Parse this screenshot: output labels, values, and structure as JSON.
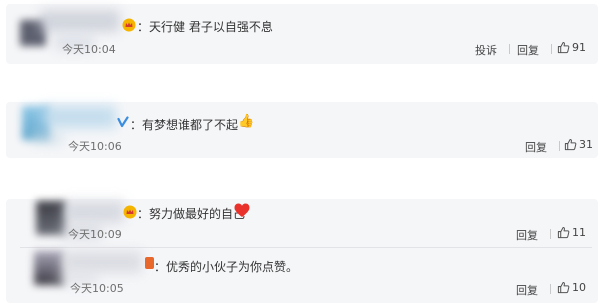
{
  "comments": [
    {
      "text": "：天行健 君子以自强不息",
      "time": "今天10:04",
      "actions": [
        "投诉",
        "回复"
      ],
      "likes": "91"
    },
    {
      "text": "：有梦想谁都了不起",
      "emoji": "👍",
      "time": "今天10:06",
      "actions": [
        "回复"
      ],
      "likes": "31"
    },
    {
      "text": "：努力做最好的自己",
      "emoji": "❤",
      "time": "今天10:09",
      "actions": [
        "回复"
      ],
      "likes": "11"
    },
    {
      "text": "：优秀的小伙子为你点赞。",
      "time": "今天10:05",
      "actions": [
        "回复"
      ],
      "likes": "10"
    }
  ],
  "colors": {
    "card_bg": "#f5f6f8",
    "verified_blue": "#3b8de0",
    "badge_gold": "#f4b400",
    "heart_red": "#e8322b",
    "text": "#333333",
    "muted": "#6f6f6f"
  },
  "icons": [
    "thumbs-up-icon",
    "verified-v-icon",
    "vip-crown-badge",
    "red-heart-icon",
    "thumbs-up-emoji"
  ]
}
